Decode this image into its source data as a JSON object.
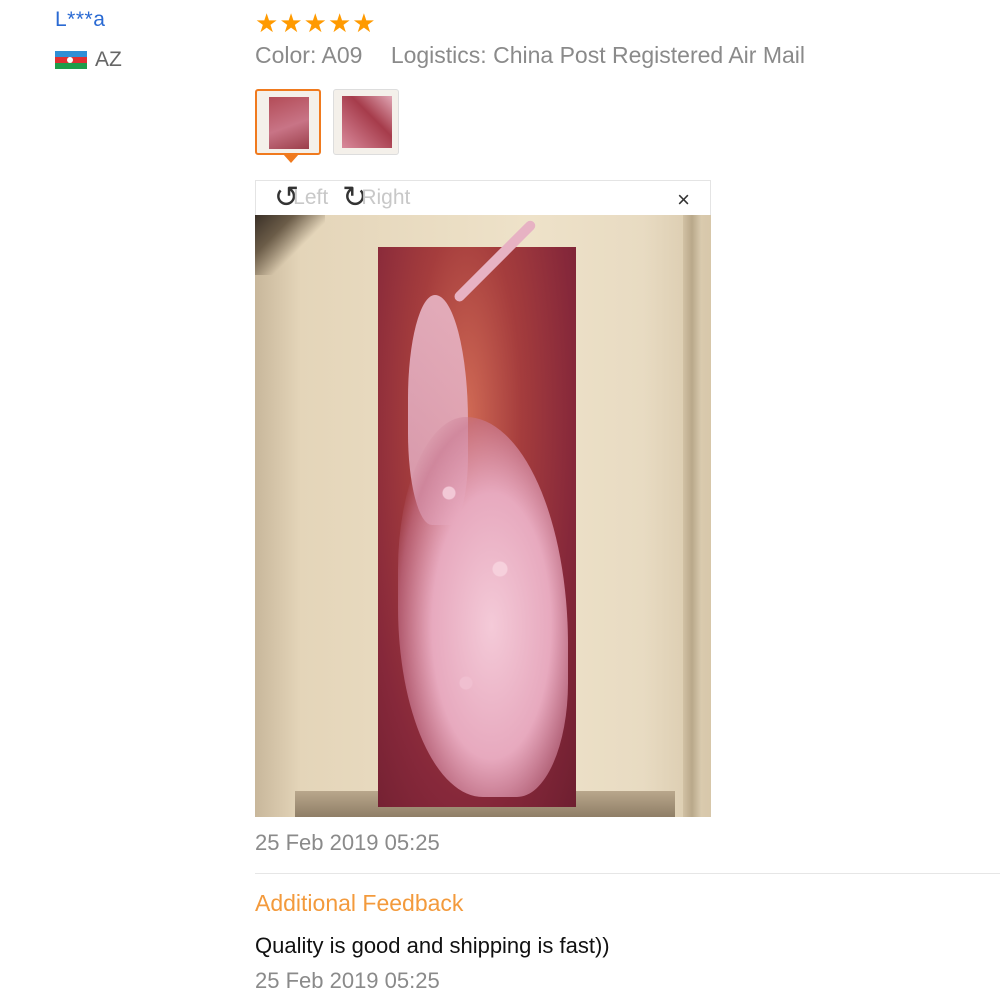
{
  "reviewer": {
    "name": "L***a",
    "country_code": "AZ",
    "flag_icon": "azerbaijan-flag-icon"
  },
  "review": {
    "rating": 5,
    "rating_max": 5,
    "color_label": "Color:",
    "color_value": "A09",
    "logistics_label": "Logistics:",
    "logistics_value": "China Post Registered Air Mail",
    "thumbnails": [
      "review-photo-1",
      "review-photo-2"
    ],
    "active_thumbnail": 0,
    "viewer": {
      "rotate_left_label": "Left",
      "rotate_right_label": "Right",
      "close_label": "×"
    },
    "date": "25 Feb 2019 05:25"
  },
  "additional_feedback": {
    "title": "Additional Feedback",
    "text": "Quality is good and shipping is fast))",
    "date": "25 Feb 2019 05:25"
  },
  "colors": {
    "star": "#ff9a00",
    "accent_orange": "#f07a1e",
    "link_blue": "#2a6ad3",
    "muted_text": "#8a8a8a"
  }
}
